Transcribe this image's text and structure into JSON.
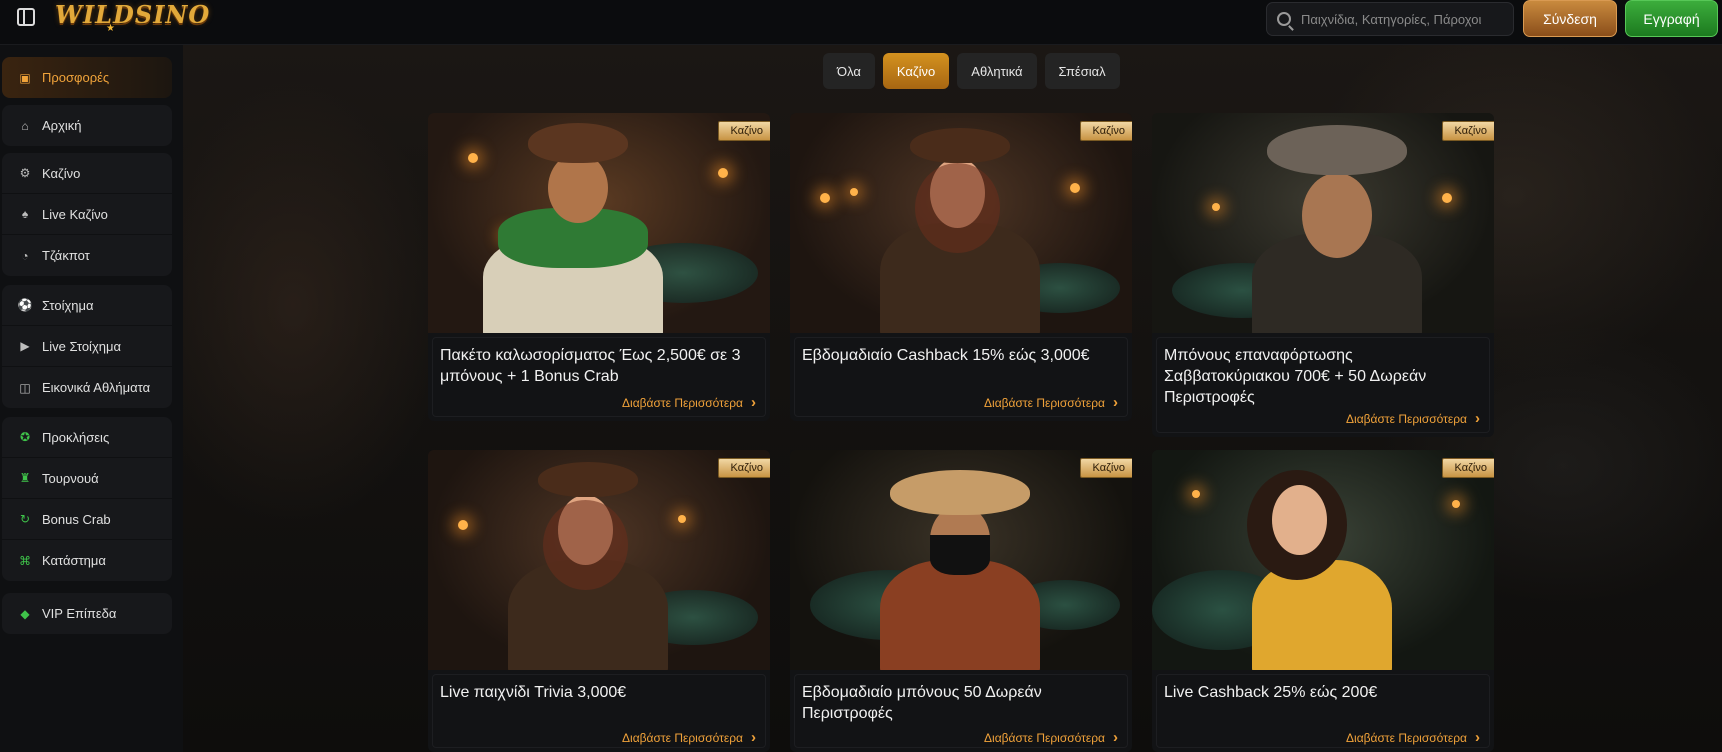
{
  "header": {
    "logo": "WILDSINO",
    "search_placeholder": "Παιχνίδια, Κατηγορίες, Πάροχοι",
    "login_label": "Σύνδεση",
    "register_label": "Εγγραφή"
  },
  "sidebar": {
    "groups": [
      {
        "items": [
          {
            "label": "Προσφορές",
            "icon": "promotions-icon",
            "active": true
          }
        ]
      },
      {
        "items": [
          {
            "label": "Αρχική",
            "icon": "home-icon"
          }
        ]
      },
      {
        "items": [
          {
            "label": "Καζίνο",
            "icon": "casino-chip-icon"
          },
          {
            "label": "Live Καζίνο",
            "icon": "live-casino-icon"
          },
          {
            "label": "Τζάκποτ",
            "icon": "jackpot-icon"
          }
        ]
      },
      {
        "items": [
          {
            "label": "Στοίχημα",
            "icon": "soccer-ball-icon"
          },
          {
            "label": "Live Στοίχημα",
            "icon": "live-betting-icon"
          },
          {
            "label": "Εικονικά Αθλήματα",
            "icon": "virtual-sports-icon"
          }
        ]
      },
      {
        "items": [
          {
            "label": "Προκλήσεις",
            "icon": "challenges-icon"
          },
          {
            "label": "Τουρνουά",
            "icon": "trophy-icon"
          },
          {
            "label": "Bonus Crab",
            "icon": "crab-icon"
          },
          {
            "label": "Κατάστημα",
            "icon": "shop-icon"
          }
        ]
      },
      {
        "items": [
          {
            "label": "VIP Επίπεδα",
            "icon": "diamond-icon"
          }
        ]
      }
    ]
  },
  "filters": [
    {
      "label": "Όλα",
      "active": false
    },
    {
      "label": "Καζίνο",
      "active": true
    },
    {
      "label": "Αθλητικά",
      "active": false
    },
    {
      "label": "Σπέσιαλ",
      "active": false
    }
  ],
  "promotions": [
    {
      "title": "Πακέτο καλωσορίσματος Έως 2,500€ σε 3 μπόνους + 1 Bonus Crab",
      "badge": "Καζίνο",
      "link": "Διαβάστε Περισσότερα"
    },
    {
      "title": "Εβδομαδιαίο Cashback 15% εώς 3,000€",
      "badge": "Καζίνο",
      "link": "Διαβάστε Περισσότερα"
    },
    {
      "title": "Μπόνους επαναφόρτωσης Σαββατοκύριακου 700€ + 50 Δωρεάν Περιστροφές",
      "badge": "Καζίνο",
      "link": "Διαβάστε Περισσότερα"
    },
    {
      "title": "Live παιχνίδι Trivia 3,000€",
      "badge": "Καζίνο",
      "link": "Διαβάστε Περισσότερα"
    },
    {
      "title": "Εβδομαδιαίο μπόνους 50 Δωρεάν Περιστροφές",
      "badge": "Καζίνο",
      "link": "Διαβάστε Περισσότερα"
    },
    {
      "title": "Live Cashback 25% εώς 200€",
      "badge": "Καζίνο",
      "link": "Διαβάστε Περισσότερα"
    }
  ],
  "colors": {
    "accent": "#f0a23a",
    "register": "#2e9a30",
    "login": "#b0702e"
  }
}
